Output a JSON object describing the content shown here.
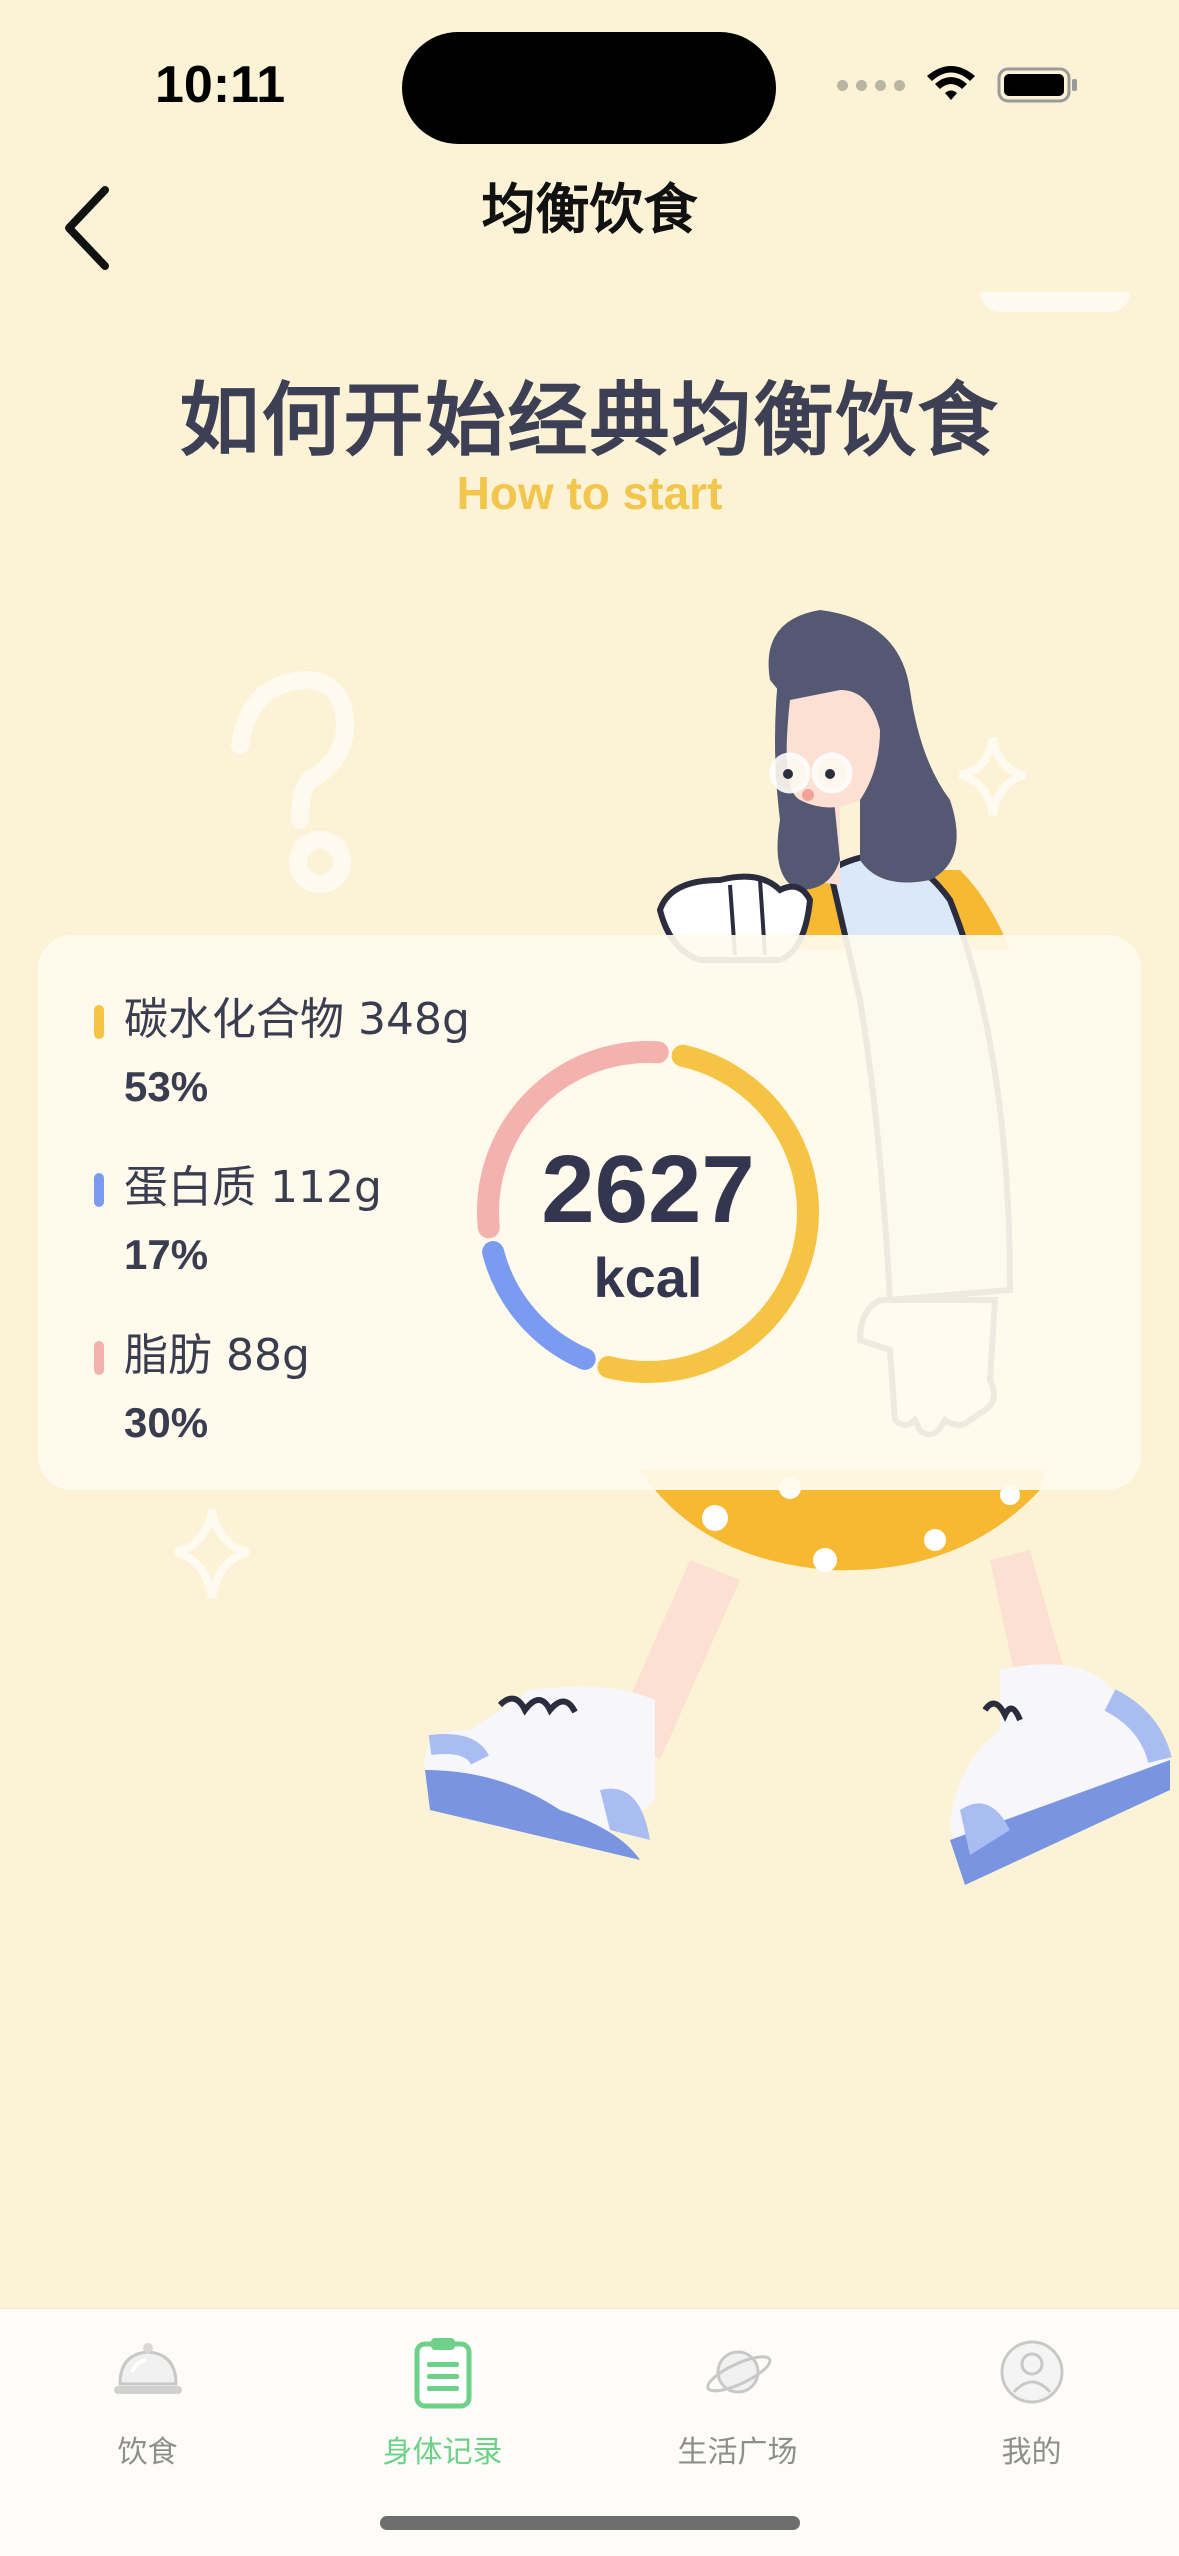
{
  "status_bar": {
    "time": "10:11"
  },
  "nav": {
    "title": "均衡饮食",
    "back_icon": "chevron-left-icon"
  },
  "hero": {
    "title": "如何开始经典均衡饮食",
    "subtitle": "How to start"
  },
  "nutrition": {
    "total_value": "2627",
    "total_unit": "kcal",
    "items": [
      {
        "label": "碳水化合物 348g",
        "percent": "53%",
        "color": "#f5c444",
        "fraction": 0.53
      },
      {
        "label": "蛋白质 112g",
        "percent": "17%",
        "color": "#7b9bf0",
        "fraction": 0.17
      },
      {
        "label": "脂肪 88g",
        "percent": "30%",
        "color": "#f4b2ae",
        "fraction": 0.3
      }
    ]
  },
  "tabbar": {
    "tabs": [
      {
        "label": "饮食",
        "icon": "food-cloche-icon",
        "active": false
      },
      {
        "label": "身体记录",
        "icon": "clipboard-icon",
        "active": true
      },
      {
        "label": "生活广场",
        "icon": "planet-icon",
        "active": false
      },
      {
        "label": "我的",
        "icon": "profile-icon",
        "active": false
      }
    ]
  },
  "colors": {
    "background": "#fcf3d6",
    "accent_green": "#6fd08a",
    "title_dark": "#3d3f55",
    "subtitle_yellow": "#f2c64c"
  }
}
